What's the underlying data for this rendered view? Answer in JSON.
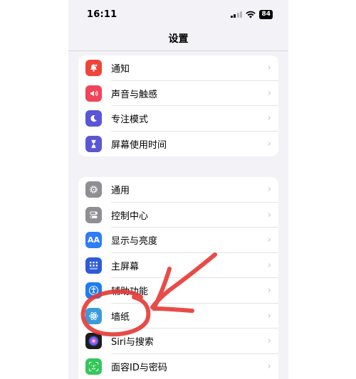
{
  "status_bar": {
    "time": "16:11",
    "battery": "84"
  },
  "nav": {
    "title": "设置"
  },
  "groups": [
    {
      "items": [
        {
          "label": "通知",
          "icon": "bell-icon",
          "color": "#f0443a"
        },
        {
          "label": "声音与触感",
          "icon": "speaker-icon",
          "color": "#f0445a"
        },
        {
          "label": "专注模式",
          "icon": "moon-icon",
          "color": "#5a56d8"
        },
        {
          "label": "屏幕使用时间",
          "icon": "hourglass-icon",
          "color": "#5a56d8"
        }
      ]
    },
    {
      "items": [
        {
          "label": "通用",
          "icon": "gear-icon",
          "color": "#8e8e93"
        },
        {
          "label": "控制中心",
          "icon": "toggles-icon",
          "color": "#8e8e93"
        },
        {
          "label": "显示与亮度",
          "icon": "text-size-icon",
          "color": "#2f7cf6",
          "icon_text": "AA"
        },
        {
          "label": "主屏幕",
          "icon": "home-grid-icon",
          "color": "#2f5bd6"
        },
        {
          "label": "辅助功能",
          "icon": "accessibility-icon",
          "color": "#1f7cf0"
        },
        {
          "label": "墙纸",
          "icon": "atom-icon",
          "color": "#3a9bd9"
        },
        {
          "label": "Siri与搜索",
          "icon": "siri-icon",
          "color": "#1c1c1e"
        },
        {
          "label": "面容ID与密码",
          "icon": "face-id-icon",
          "color": "#34c759"
        }
      ]
    }
  ],
  "chevron": "›",
  "annotation": {
    "color": "#e53935"
  }
}
